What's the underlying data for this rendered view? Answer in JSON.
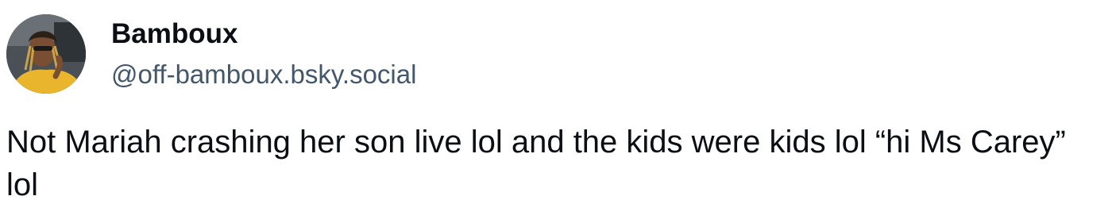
{
  "post": {
    "author": {
      "display_name": "Bamboux",
      "handle": "@off-bamboux.bsky.social",
      "avatar_icon": "user-avatar-photo"
    },
    "text": "Not Mariah crashing her son live lol and the kids were kids lol “hi Ms Carey” lol"
  }
}
